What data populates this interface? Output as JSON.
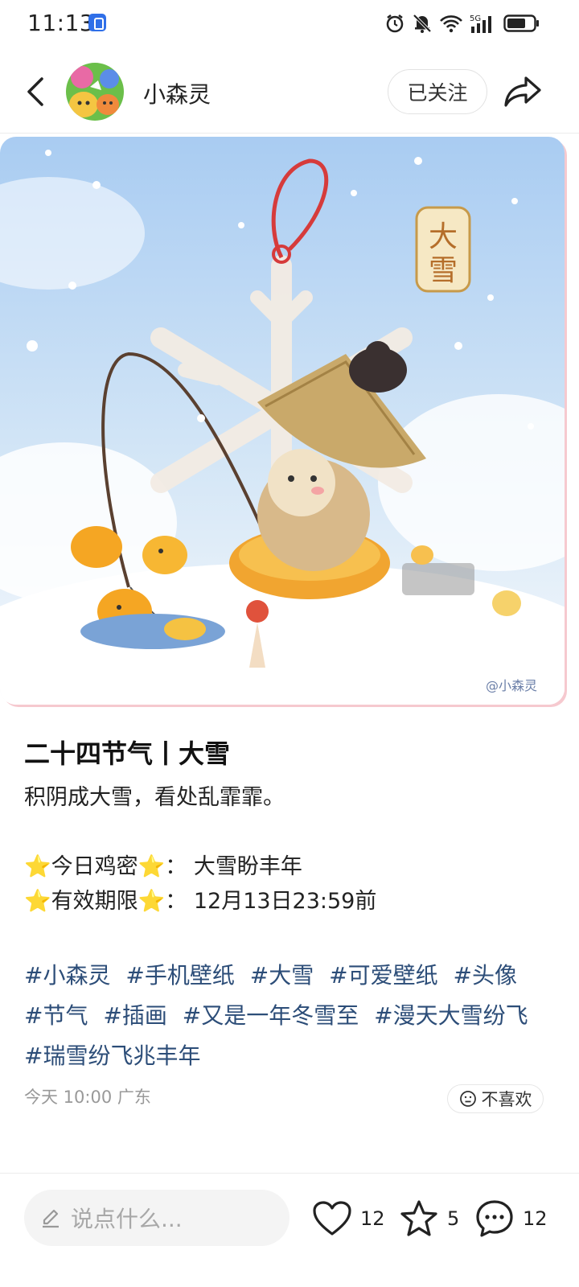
{
  "status_bar": {
    "time": "11:13",
    "network": "5G",
    "icons": [
      "alarm-icon",
      "mute-icon",
      "wifi-icon",
      "signal-icon",
      "battery-icon"
    ]
  },
  "header": {
    "author_name": "小森灵",
    "follow_label": "已关注"
  },
  "image": {
    "badge_text_1": "大",
    "badge_text_2": "雪",
    "watermark": "@小森灵",
    "colors": {
      "sky": "#bcd9f2",
      "snow": "#ffffff",
      "accent": "#d63b3b"
    }
  },
  "post": {
    "title": "二十四节气丨大雪",
    "subtitle": "积阴成大雪，看处乱霏霏。",
    "line1_star_a": "⭐",
    "line1_label": "今日鸡密",
    "line1_star_b": "⭐",
    "line1_value": "：  大雪盼丰年",
    "line2_star_a": "⭐",
    "line2_label": "有效期限",
    "line2_star_b": "⭐",
    "line2_value": "：  12月13日23:59前",
    "tags": [
      "#小森灵",
      "#手机壁纸",
      "#大雪",
      "#可爱壁纸",
      "#头像",
      "#节气",
      "#插画",
      "#又是一年冬雪至",
      "#漫天大雪纷飞",
      "#瑞雪纷飞兆丰年"
    ],
    "meta": "今天 10:00 广东",
    "dislike_label": "不喜欢"
  },
  "bottom_bar": {
    "comment_placeholder": "说点什么...",
    "like_count": "12",
    "favorite_count": "5",
    "comment_count": "12"
  }
}
